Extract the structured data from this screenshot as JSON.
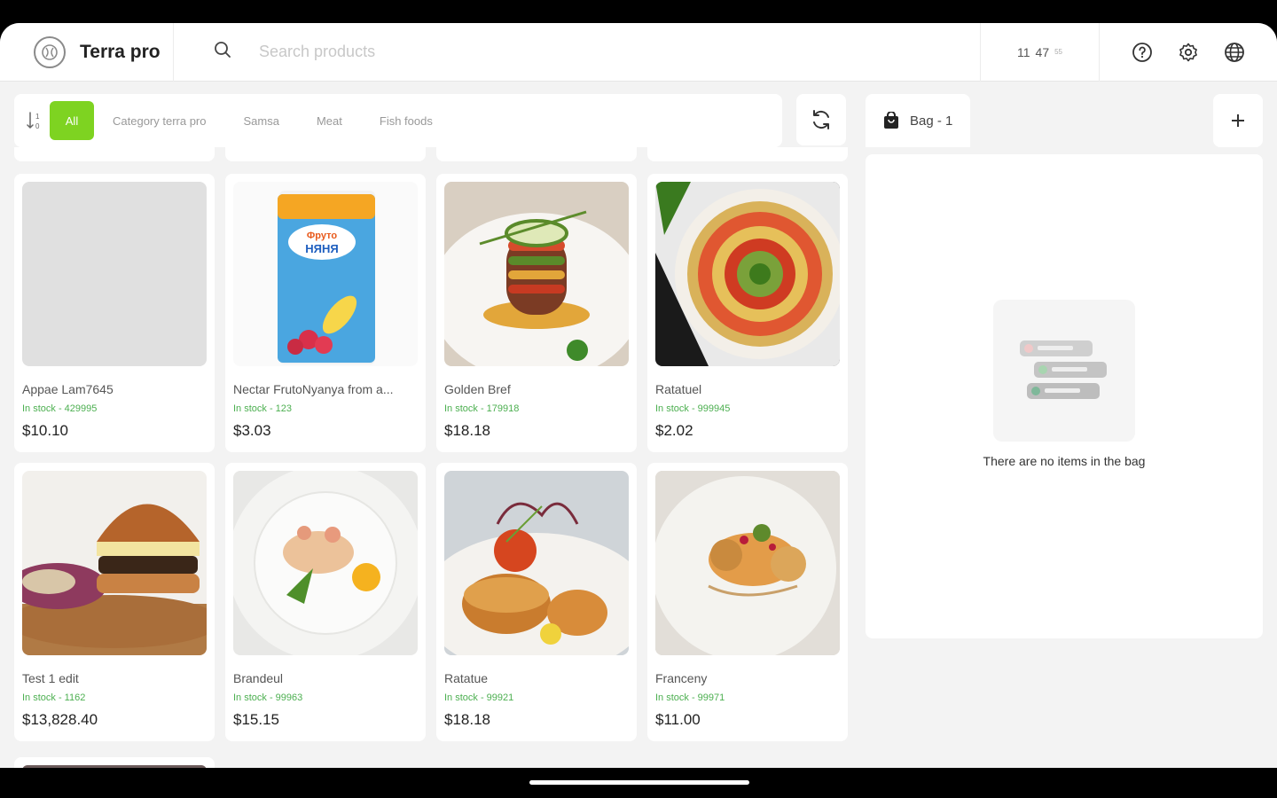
{
  "header": {
    "brand_name": "Terra pro",
    "search_placeholder": "Search products",
    "clock_hours": "11",
    "clock_minutes": "47",
    "clock_seconds": "55"
  },
  "categories": {
    "items": [
      "All",
      "Category terra pro",
      "Samsa",
      "Meat",
      "Fish foods"
    ],
    "active": "All"
  },
  "products": [
    {
      "name": "Appae Lam7645",
      "stock": "In stock - 429995",
      "price": "$10.10"
    },
    {
      "name": "Nectar FrutoNyanya from a...",
      "stock": "In stock - 123",
      "price": "$3.03"
    },
    {
      "name": "Golden Bref",
      "stock": "In stock - 179918",
      "price": "$18.18"
    },
    {
      "name": "Ratatuel",
      "stock": "In stock - 999945",
      "price": "$2.02"
    },
    {
      "name": "Test 1 edit",
      "stock": "In stock - 1162",
      "price": "$13,828.40"
    },
    {
      "name": "Brandeul",
      "stock": "In stock - 99963",
      "price": "$15.15"
    },
    {
      "name": "Ratatue",
      "stock": "In stock - 99921",
      "price": "$18.18"
    },
    {
      "name": "Franceny",
      "stock": "In stock - 99971",
      "price": "$11.00"
    }
  ],
  "bag": {
    "tab_label": "Bag - 1",
    "empty_message": "There are no items in the bag"
  },
  "colors": {
    "accent": "#7ed321",
    "stock": "#4caf50"
  }
}
